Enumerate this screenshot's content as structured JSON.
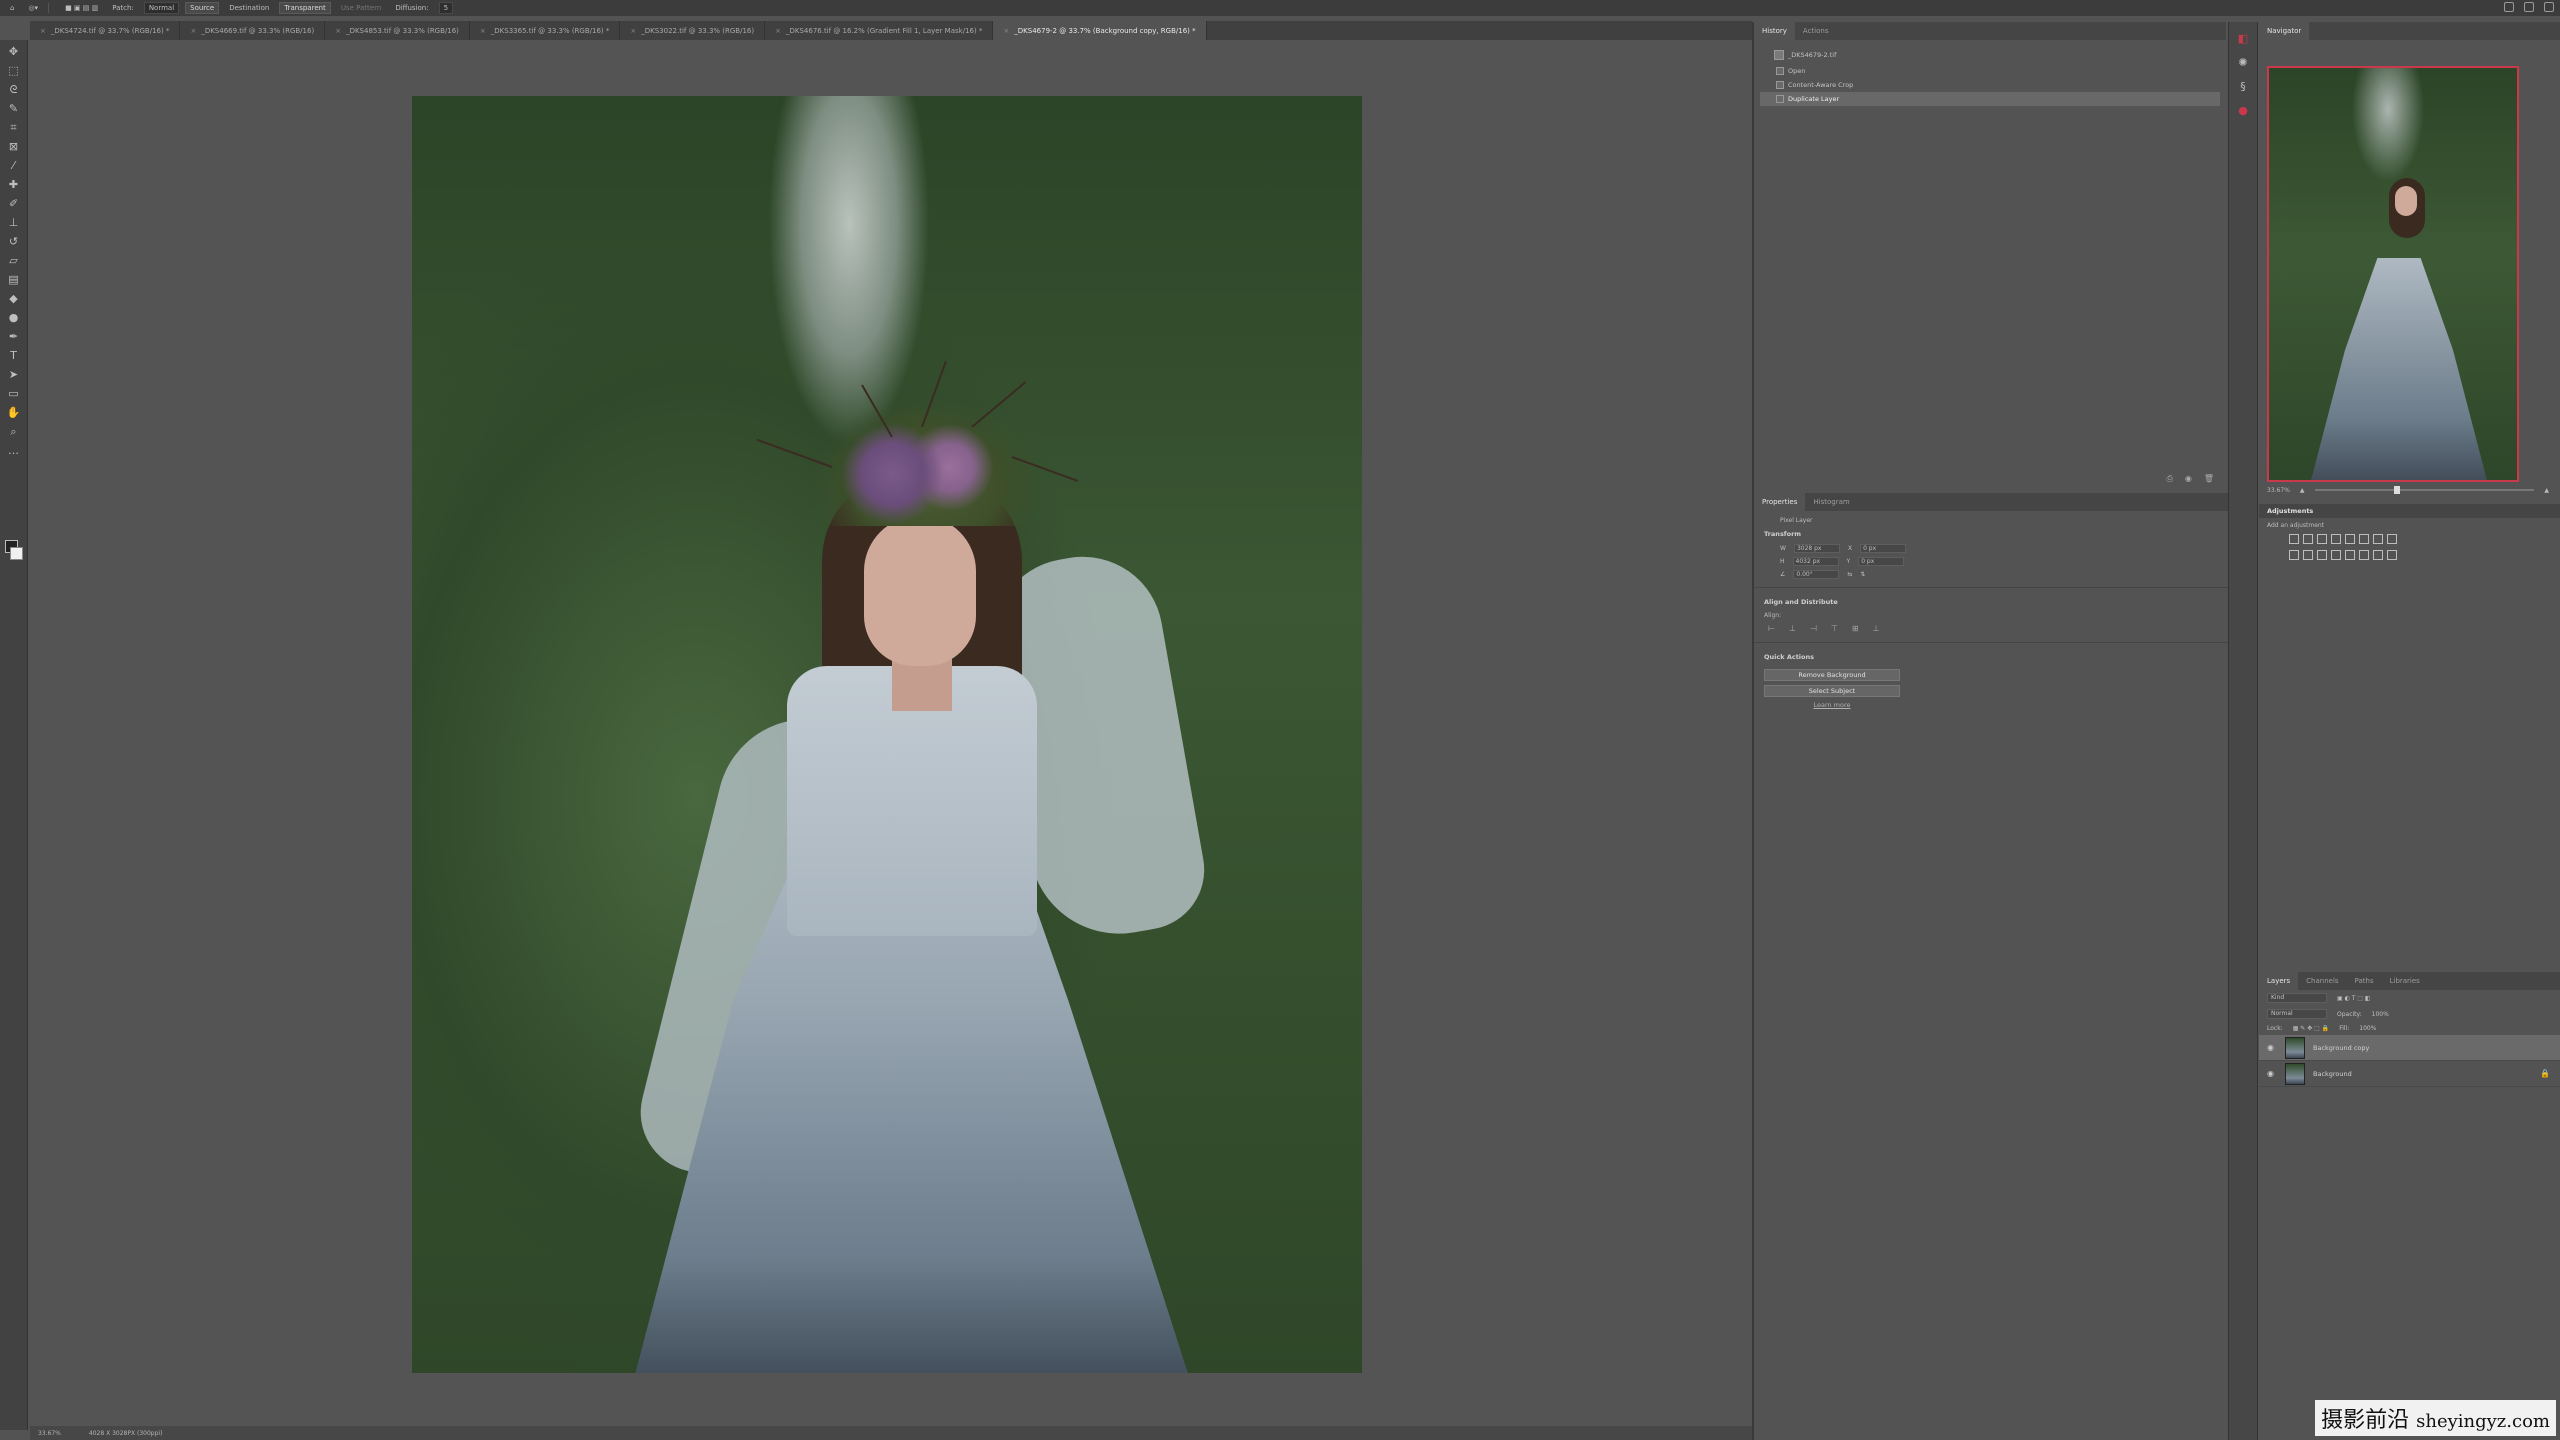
{
  "options_bar": {
    "patch_label": "Patch:",
    "patch_value": "Normal",
    "source_label": "Source",
    "destination_label": "Destination",
    "transparent_label": "Transparent",
    "use_pattern_label": "Use Pattern",
    "diffusion_label": "Diffusion:",
    "diffusion_value": "5"
  },
  "tabs": [
    {
      "label": "_DKS4724.tif @ 33.7% (RGB/16) *"
    },
    {
      "label": "_DKS4669.tif @ 33.3% (RGB/16)"
    },
    {
      "label": "_DKS4853.tif @ 33.3% (RGB/16)"
    },
    {
      "label": "_DKS3365.tif @ 33.3% (RGB/16) *"
    },
    {
      "label": "_DKS3022.tif @ 33.3% (RGB/16)"
    },
    {
      "label": "_DKS4676.tif @ 16.2% (Gradient Fill 1, Layer Mask/16) *"
    },
    {
      "label": "_DKS4679-2 @ 33.7% (Background copy, RGB/16) *"
    }
  ],
  "history": {
    "tab_active": "History",
    "tab_other": "Actions",
    "snapshot": "_DKS4679-2.tif",
    "items": [
      {
        "label": "Open"
      },
      {
        "label": "Content-Aware Crop"
      },
      {
        "label": "Duplicate Layer"
      }
    ]
  },
  "properties": {
    "tab_active": "Properties",
    "tab_other": "Histogram",
    "layer_kind": "Pixel Layer",
    "transform_title": "Transform",
    "w_label": "W",
    "w_value": "3028 px",
    "h_label": "H",
    "h_value": "4032 px",
    "x_label": "X",
    "x_value": "0 px",
    "y_label": "Y",
    "y_value": "0 px",
    "angle_value": "0.00°",
    "align_title": "Align and Distribute",
    "align_label": "Align:",
    "quick_actions_title": "Quick Actions",
    "remove_bg_label": "Remove Background",
    "select_subject_label": "Select Subject",
    "learn_more_label": "Learn more"
  },
  "navigator": {
    "tab_label": "Navigator",
    "zoom_value": "33.67%",
    "zoom_level": 0.36
  },
  "adjustments": {
    "title": "Adjustments",
    "hint": "Add an adjustment"
  },
  "layers": {
    "tabs": [
      "Layers",
      "Channels",
      "Paths",
      "Libraries"
    ],
    "kind_label": "Kind",
    "blend_mode": "Normal",
    "opacity_label": "Opacity:",
    "opacity_value": "100%",
    "lock_label": "Lock:",
    "fill_label": "Fill:",
    "fill_value": "100%",
    "items": [
      {
        "name": "Background copy",
        "selected": true
      },
      {
        "name": "Background",
        "locked": true
      }
    ]
  },
  "status": {
    "zoom": "33.67%",
    "doc_size": "4028 X 3028PX (300ppi)"
  },
  "watermark": {
    "text_cn": "摄影前沿",
    "text_url": "sheyingyz.com"
  },
  "colors": {
    "accent_nav_frame": "#c9384b",
    "panel_bg": "#535353"
  }
}
